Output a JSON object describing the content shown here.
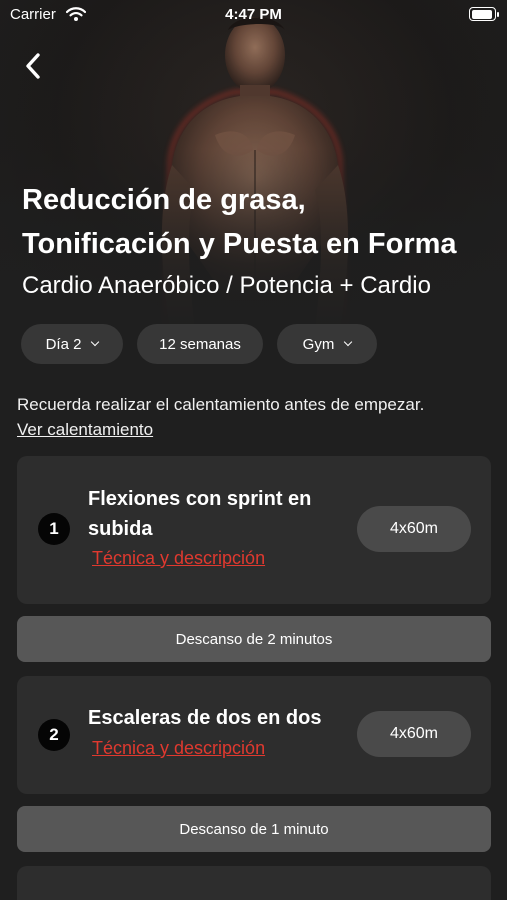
{
  "status_bar": {
    "carrier": "Carrier",
    "time": "4:47 PM",
    "icons": [
      "wifi-icon",
      "battery-icon"
    ]
  },
  "header": {
    "back_icon": "back-chevron-icon",
    "title_line1": "Reducción de grasa,",
    "title_line2": "Tonificación y Puesta en Forma",
    "subtitle": "Cardio Anaeróbico / Potencia + Cardio"
  },
  "filters": {
    "day": "Día 2",
    "weeks": "12 semanas",
    "place": "Gym"
  },
  "reminder": {
    "text": "Recuerda realizar el calentamiento antes de empezar.",
    "link": "Ver calentamiento"
  },
  "exercises": [
    {
      "number": "1",
      "name": "Flexiones con sprint en subida",
      "link": "Técnica y descripción",
      "sets": "4x60m"
    },
    {
      "number": "2",
      "name": "Escaleras de dos en dos",
      "link": "Técnica y descripción",
      "sets": "4x60m"
    }
  ],
  "rests": [
    "Descanso de 2 minutos",
    "Descanso de 1 minuto"
  ],
  "colors": {
    "background": "#1f1f1f",
    "card": "#2d2d2d",
    "chip": "#373737",
    "rest_bar": "#575757",
    "link_accent": "#e0392f"
  }
}
